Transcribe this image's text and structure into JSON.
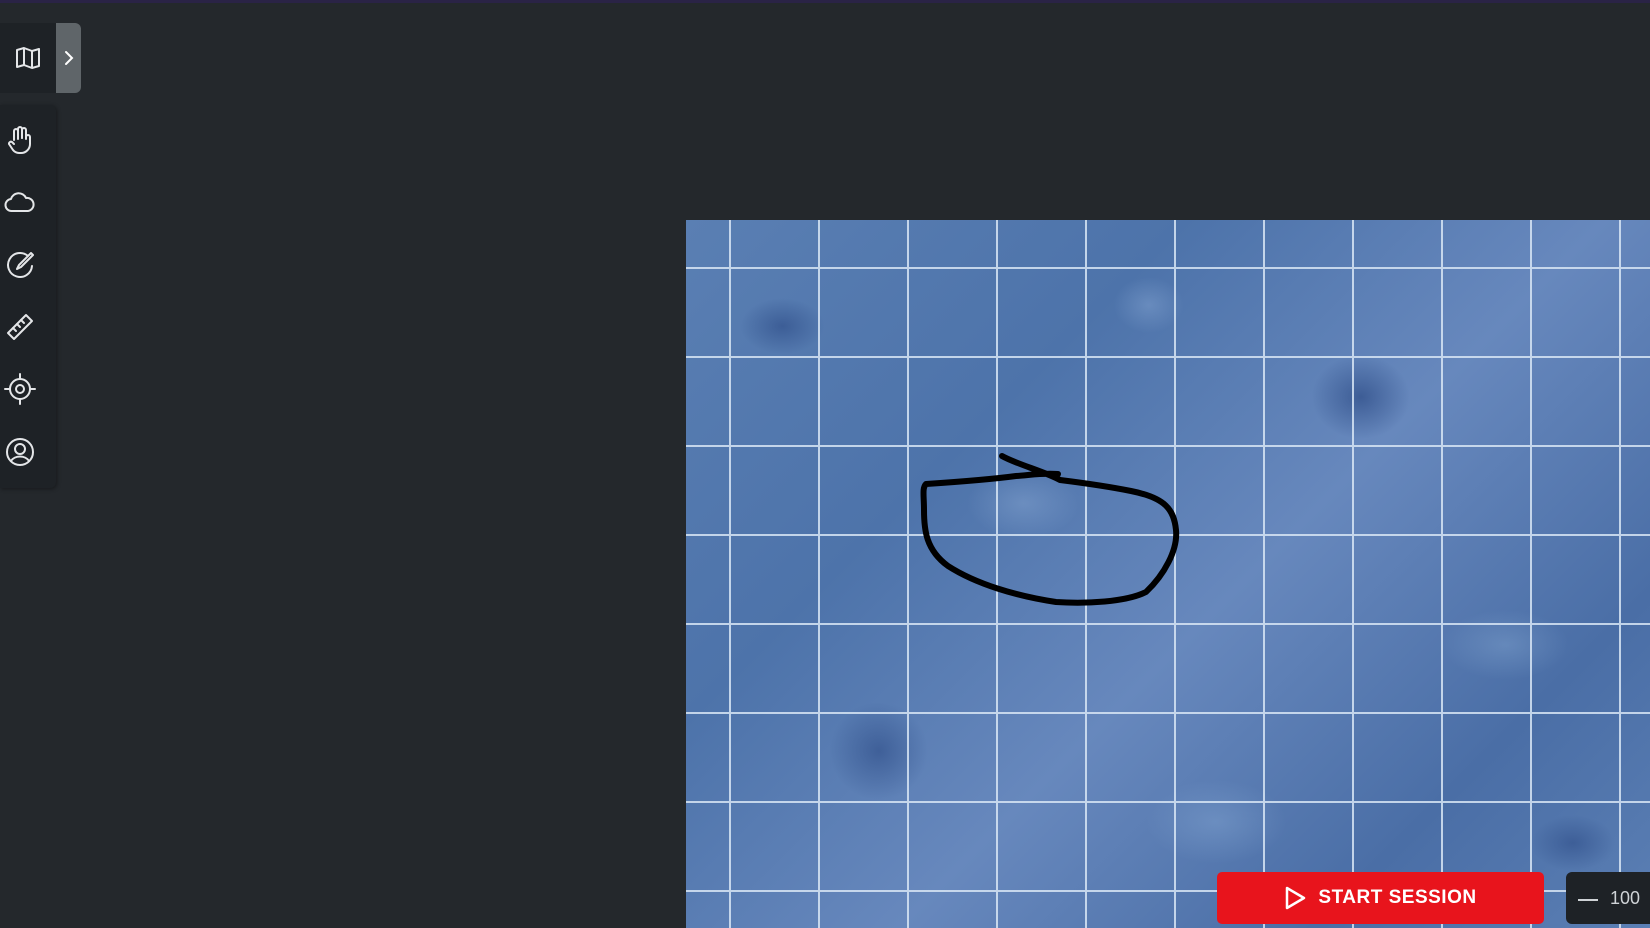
{
  "toolbar": {
    "map_icon": "map-icon",
    "expand_icon": "chevron-right-icon",
    "tools": [
      {
        "name": "move-tool",
        "icon": "hand-icon"
      },
      {
        "name": "fog-tool",
        "icon": "cloud-icon"
      },
      {
        "name": "drawing-tool",
        "icon": "pencil-circle-icon"
      },
      {
        "name": "measure-tool",
        "icon": "ruler-icon"
      },
      {
        "name": "pointer-tool",
        "icon": "crosshair-icon"
      },
      {
        "name": "note-tool",
        "icon": "user-circle-icon"
      }
    ]
  },
  "session": {
    "start_label": "START SESSION"
  },
  "zoom": {
    "value": "100"
  },
  "colors": {
    "background": "#24282c",
    "toolbar": "#1e2226",
    "accent": "#e8141c",
    "map_water": "#5a7fb3",
    "grid_line": "#d8e6f5",
    "drawing_stroke": "#000000"
  }
}
